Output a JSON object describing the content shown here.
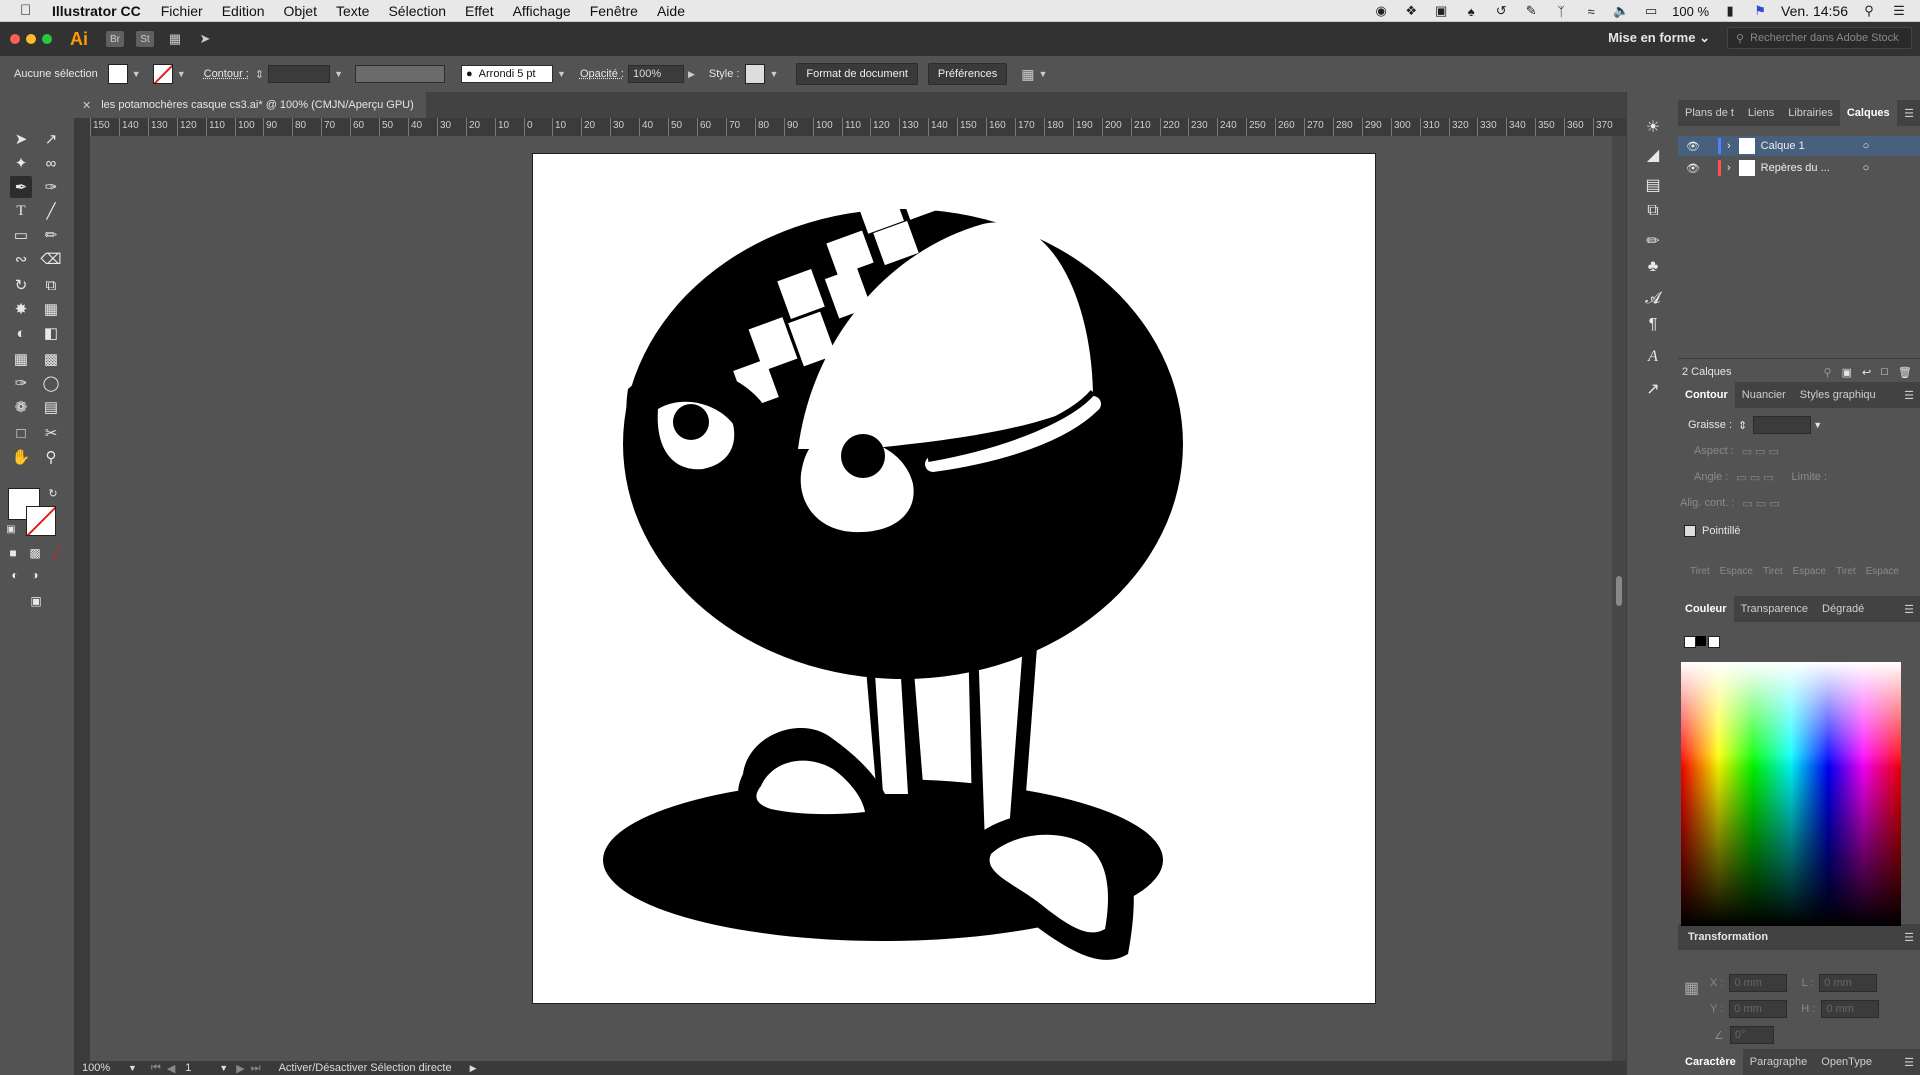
{
  "menubar": {
    "app_name": "Illustrator CC",
    "items": [
      "Fichier",
      "Edition",
      "Objet",
      "Texte",
      "Sélection",
      "Effet",
      "Affichage",
      "Fenêtre",
      "Aide"
    ],
    "zoom": "100 %",
    "clock": "Ven. 14:56"
  },
  "appbar": {
    "logo": "Ai",
    "bridge": "Br",
    "stock": "St",
    "workspace": "Mise en forme",
    "stock_search_placeholder": "Rechercher dans Adobe Stock"
  },
  "controlbar": {
    "selection_label": "Aucune sélection",
    "stroke_label": "Contour :",
    "brush_label": "Arrondi 5 pt",
    "opacity_label": "Opacité :",
    "opacity_value": "100%",
    "style_label": "Style :",
    "doc_format_button": "Format de document",
    "prefs_button": "Préférences"
  },
  "document": {
    "tab_title": "les potamochères casque cs3.ai* @ 100% (CMJN/Aperçu GPU)"
  },
  "ruler": {
    "labels": [
      "150",
      "140",
      "130",
      "120",
      "110",
      "100",
      "90",
      "80",
      "70",
      "60",
      "50",
      "40",
      "30",
      "20",
      "10",
      "0",
      "10",
      "20",
      "30",
      "40",
      "50",
      "60",
      "70",
      "80",
      "90",
      "100",
      "110",
      "120",
      "130",
      "140",
      "150",
      "160",
      "170",
      "180",
      "190",
      "200",
      "210",
      "220",
      "230",
      "240",
      "250",
      "260",
      "270",
      "280",
      "290",
      "300",
      "310",
      "320",
      "330",
      "340",
      "350",
      "360",
      "370"
    ]
  },
  "statusbar": {
    "zoom": "100%",
    "page": "1",
    "hint": "Activer/Désactiver Sélection directe"
  },
  "layers_panel": {
    "tabs": [
      "Plans de t",
      "Liens",
      "Librairies",
      "Calques"
    ],
    "active_tab": "Calques",
    "layers": [
      {
        "name": "Calque 1",
        "color": "#4f80ff"
      },
      {
        "name": "Repères du ...",
        "color": "#ff4f4f"
      }
    ],
    "count": "2 Calques"
  },
  "stroke_panel": {
    "tabs": [
      "Contour",
      "Nuancier",
      "Styles graphiqu"
    ],
    "weight_label": "Graisse :",
    "aspect_label": "Aspect :",
    "angle_label": "Angle :",
    "limit_label": "Limite :",
    "align_label": "Alig. cont. :",
    "dashed_label": "Pointillé",
    "dash_fields": [
      "Tiret",
      "Espace",
      "Tiret",
      "Espace",
      "Tiret",
      "Espace"
    ]
  },
  "color_panel": {
    "tabs": [
      "Couleur",
      "Transparence",
      "Dégradé"
    ]
  },
  "transform_panel": {
    "title": "Transformation",
    "x_label": "X :",
    "y_label": "Y :",
    "l_label": "L :",
    "h_label": "H :",
    "x_value": "0 mm",
    "y_value": "0 mm",
    "l_value": "0 mm",
    "h_value": "0 mm",
    "angle_value": "0°"
  },
  "char_panel": {
    "tabs": [
      "Caractère",
      "Paragraphe",
      "OpenType"
    ]
  },
  "colors": {
    "accent_layer": "#46607e",
    "ai_orange": "#ff9a00"
  }
}
